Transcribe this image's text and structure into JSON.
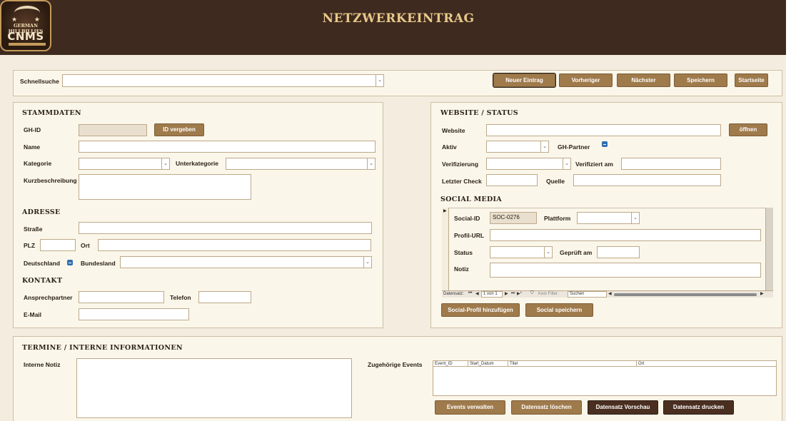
{
  "header": {
    "title": "NETZWERKEINTRAG",
    "logo_line1": "GERMAN HILLBILLIES",
    "logo_line2": "CNMS"
  },
  "toolbar": {
    "quicksearch_label": "Schnellsuche",
    "quicksearch_value": "",
    "buttons": [
      "Neuer Eintrag",
      "Vorheriger",
      "Nächster",
      "Speichern",
      "Startseite"
    ]
  },
  "stammdaten": {
    "heading": "STAMMDATEN",
    "gh_id_label": "GH-ID",
    "gh_id_value": "",
    "id_button": "ID vergeben",
    "name_label": "Name",
    "name_value": "",
    "kategorie_label": "Kategorie",
    "unterkategorie_label": "Unterkategorie",
    "kurzbeschreibung_label": "Kurzbeschreibung"
  },
  "adresse": {
    "heading": "ADRESSE",
    "strasse_label": "Straße",
    "plz_label": "PLZ",
    "ort_label": "Ort",
    "deutschland_label": "Deutschland",
    "deutschland_checked": true,
    "bundesland_label": "Bundesland"
  },
  "kontakt": {
    "heading": "KONTAKT",
    "ansprechpartner_label": "Ansprechpartner",
    "telefon_label": "Telefon",
    "email_label": "E-Mail"
  },
  "website": {
    "heading": "WEBSITE / STATUS",
    "website_label": "Website",
    "open_button": "öffnen",
    "aktiv_label": "Aktiv",
    "gh_partner_label": "GH-Partner",
    "gh_partner_checked": true,
    "verifizierung_label": "Verifizierung",
    "verifiziert_am_label": "Verifiziert am",
    "letzter_check_label": "Letzter Check",
    "quelle_label": "Quelle"
  },
  "social": {
    "heading": "SOCIAL MEDIA",
    "social_id_label": "Social-ID",
    "social_id_value": "SOC-0276",
    "plattform_label": "Plattform",
    "profil_url_label": "Profil-URL",
    "status_label": "Status",
    "geprueft_label": "Geprüft am",
    "notiz_label": "Notiz",
    "nav": {
      "record_label": "Datensatz:",
      "position": "1 von 1",
      "filter": "Kein Filter",
      "search": "Suchen"
    },
    "add_button": "Social-Profil hinzufügen",
    "save_button": "Social speichern"
  },
  "termine": {
    "heading": "TERMINE / INTERNE INFORMATIONEN",
    "notiz_label": "Interne Notiz",
    "events_label": "Zugehörige Events",
    "events_columns": [
      "Event_ID",
      "Start_Datum",
      "Titel",
      "Ort"
    ],
    "buttons": [
      "Events verwalten",
      "Datensatz löschen",
      "Datensatz Vorschau",
      "Datensatz drucken"
    ]
  }
}
